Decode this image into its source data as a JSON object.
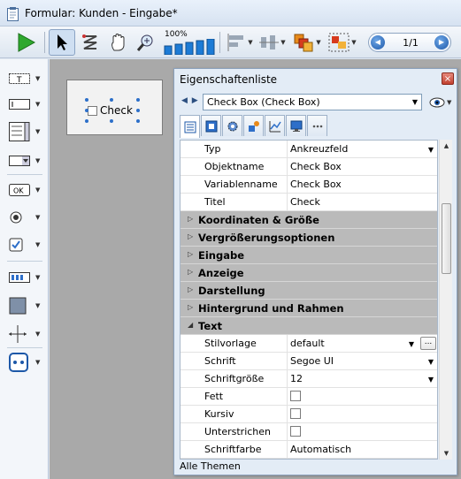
{
  "window": {
    "title": "Formular: Kunden -  Eingabe*"
  },
  "toolbar": {
    "zoom_label": "100%",
    "page_indicator": "1/1"
  },
  "form": {
    "checkbox_label": "Check"
  },
  "property_list": {
    "title": "Eigenschaftenliste",
    "close_symbol": "×",
    "object_select": "Check Box (Check Box)",
    "nav_arrows": "◀ ▶",
    "tabs": [
      "properties-icon",
      "events-icon",
      "gear-icon",
      "shapes-icon",
      "chart-icon",
      "monitor-icon",
      "more-icon"
    ],
    "rows_top": [
      {
        "name": "Typ",
        "value": "Ankreuzfeld",
        "has_dropdown": true
      },
      {
        "name": "Objektname",
        "value": "Check Box"
      },
      {
        "name": "Variablenname",
        "value": "Check Box"
      },
      {
        "name": "Titel",
        "value": "Check"
      }
    ],
    "categories": [
      {
        "name": "Koordinaten & Größe",
        "expanded": false
      },
      {
        "name": "Vergrößerungsoptionen",
        "expanded": false
      },
      {
        "name": "Eingabe",
        "expanded": false
      },
      {
        "name": "Anzeige",
        "expanded": false
      },
      {
        "name": "Darstellung",
        "expanded": false
      },
      {
        "name": "Hintergrund und Rahmen",
        "expanded": false
      },
      {
        "name": "Text",
        "expanded": true
      }
    ],
    "text_rows": [
      {
        "name": "Stilvorlage",
        "value": "default",
        "has_dropdown": true,
        "has_ellipsis": true,
        "ellipsis": "..."
      },
      {
        "name": "Schrift",
        "value": "Segoe UI",
        "has_dropdown": true
      },
      {
        "name": "Schriftgröße",
        "value": "12",
        "has_dropdown": true
      },
      {
        "name": "Fett",
        "checkbox": true,
        "checked": false
      },
      {
        "name": "Kursiv",
        "checkbox": true,
        "checked": false
      },
      {
        "name": "Unterstrichen",
        "checkbox": true,
        "checked": false
      },
      {
        "name": "Schriftfarbe",
        "value": "Automatisch"
      }
    ],
    "footer": "Alle Themen"
  },
  "colors": {
    "accent": "#1d58a8",
    "category_bg": "#bababa",
    "canvas_bg": "#a9a9a9"
  }
}
